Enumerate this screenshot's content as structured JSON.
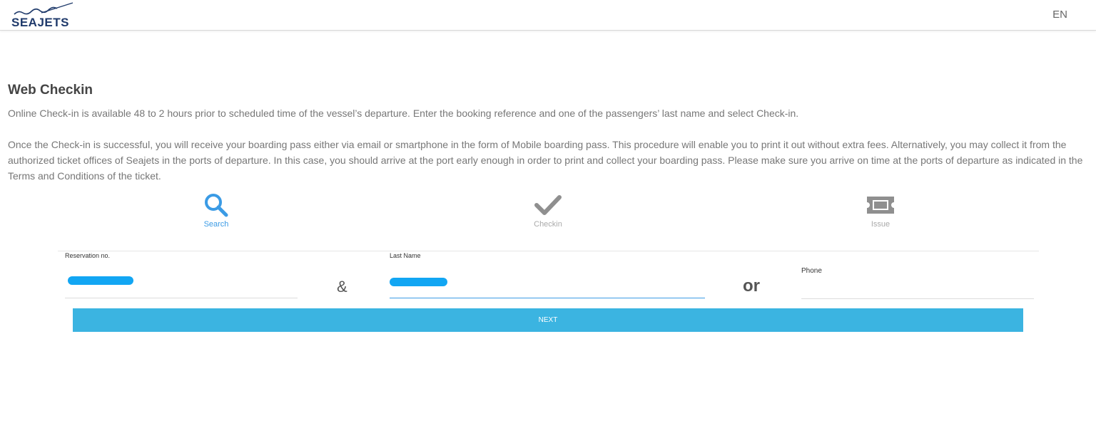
{
  "header": {
    "logo_text": "SEAJETS",
    "language": "EN"
  },
  "main": {
    "title": "Web Checkin",
    "paragraph1": "Online Check-in is available 48 to 2 hours prior to scheduled time of the vessel’s departure. Enter the booking reference and one of the passengers’ last name and select Check-in.",
    "paragraph2": "Once the Check-in is successful, you will receive your boarding pass either via email or smartphone in the form of Mobile boarding pass. This procedure will enable you to print it out without extra fees. Alternatively, you may collect it from the authorized ticket offices of Seajets in the ports of departure. In this case, you should arrive at the port early enough in order to print and collect your boarding pass. Please make sure you arrive on time at the ports of departure as indicated in the Terms and Conditions of the ticket."
  },
  "steps": [
    {
      "label": "Search",
      "icon": "search-icon",
      "active": true
    },
    {
      "label": "Checkin",
      "icon": "checkmark-icon",
      "active": false
    },
    {
      "label": "Issue",
      "icon": "ticket-icon",
      "active": false
    }
  ],
  "form": {
    "reservation_label": "Reservation no.",
    "reservation_value": "",
    "last_name_label": "Last Name",
    "last_name_value": "",
    "ampersand": "&",
    "or_text": "or",
    "phone_label": "Phone",
    "phone_value": "",
    "next_label": "NEXT"
  },
  "colors": {
    "accent": "#3b9be5",
    "button": "#3bb4e1",
    "brand": "#1f3a6b",
    "redaction": "#12a6f3"
  }
}
